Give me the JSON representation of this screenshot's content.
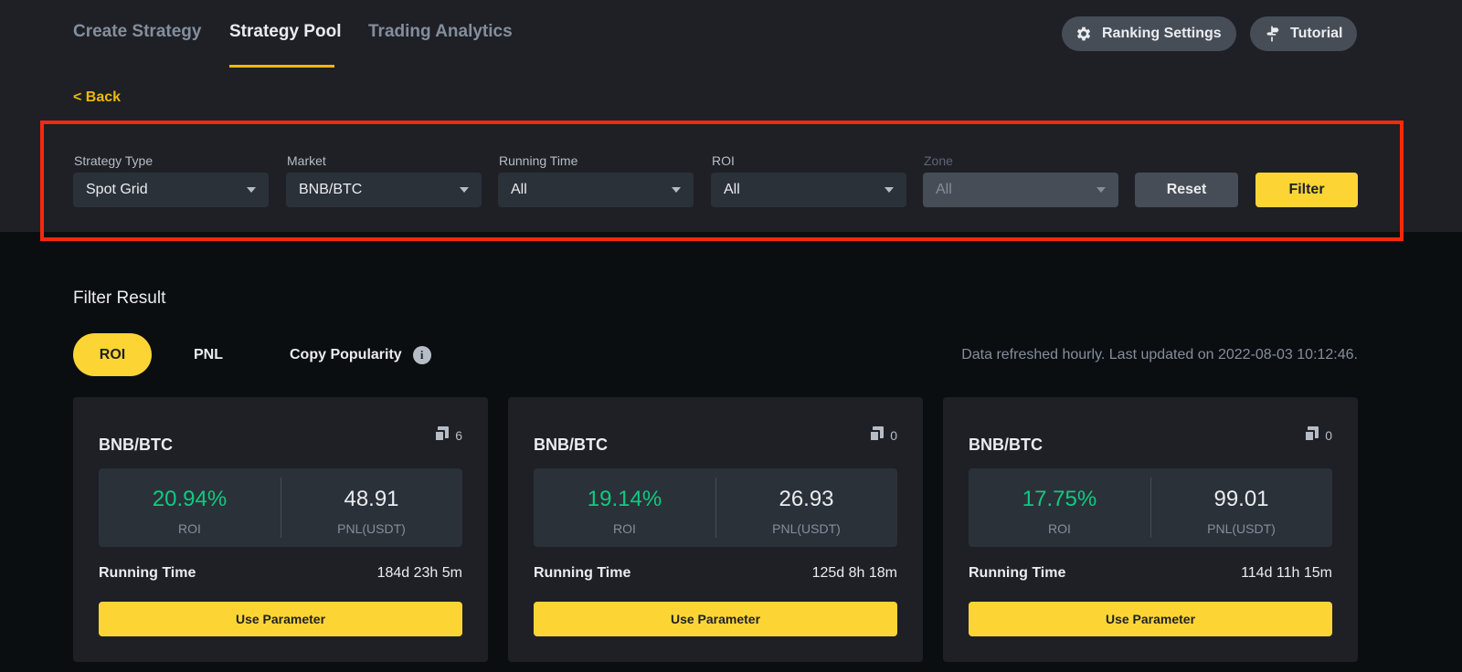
{
  "nav": {
    "tabs": [
      {
        "label": "Create Strategy"
      },
      {
        "label": "Strategy Pool"
      },
      {
        "label": "Trading Analytics"
      }
    ],
    "active_tab": "Strategy Pool",
    "ranking_settings_label": "Ranking Settings",
    "tutorial_label": "Tutorial"
  },
  "back_label": "< Back",
  "filters": {
    "strategy_type": {
      "label": "Strategy Type",
      "value": "Spot Grid"
    },
    "market": {
      "label": "Market",
      "value": "BNB/BTC"
    },
    "running_time": {
      "label": "Running Time",
      "value": "All"
    },
    "roi": {
      "label": "ROI",
      "value": "All"
    },
    "zone": {
      "label": "Zone",
      "value": "All",
      "disabled": true
    },
    "reset_label": "Reset",
    "filter_label": "Filter"
  },
  "results": {
    "title": "Filter Result",
    "sort_tabs": [
      {
        "label": "ROI"
      },
      {
        "label": "PNL"
      },
      {
        "label": "Copy Popularity"
      }
    ],
    "active_sort": "ROI",
    "info_glyph": "i",
    "refresh_note": "Data refreshed hourly. Last updated on 2022-08-03 10:12:46.",
    "cards": [
      {
        "pair": "BNB/BTC",
        "copies": "6",
        "roi": "20.94%",
        "roi_label": "ROI",
        "pnl": "48.91",
        "pnl_label": "PNL(USDT)",
        "running_time_label": "Running Time",
        "running_time": "184d 23h 5m",
        "button_label": "Use Parameter"
      },
      {
        "pair": "BNB/BTC",
        "copies": "0",
        "roi": "19.14%",
        "roi_label": "ROI",
        "pnl": "26.93",
        "pnl_label": "PNL(USDT)",
        "running_time_label": "Running Time",
        "running_time": "125d 8h 18m",
        "button_label": "Use Parameter"
      },
      {
        "pair": "BNB/BTC",
        "copies": "0",
        "roi": "17.75%",
        "roi_label": "ROI",
        "pnl": "99.01",
        "pnl_label": "PNL(USDT)",
        "running_time_label": "Running Time",
        "running_time": "114d 11h 15m",
        "button_label": "Use Parameter"
      }
    ]
  },
  "colors": {
    "accent_yellow": "#fcd535",
    "positive_green": "#0ecb81",
    "highlight_red": "#f6290c",
    "panel_bg": "#1e2026",
    "page_bg": "#0b0e11"
  },
  "icons": {
    "ranking_settings": "gear-icon",
    "tutorial": "signpost-icon",
    "info": "info-icon",
    "copy": "copy-icon",
    "dropdown": "caret-down-icon"
  }
}
